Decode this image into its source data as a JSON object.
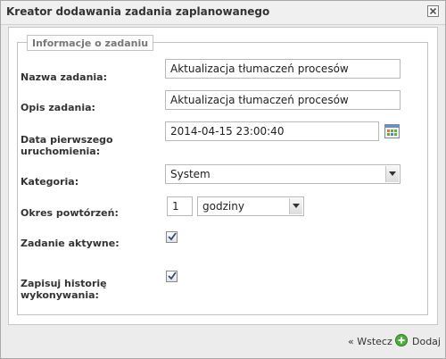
{
  "dialog": {
    "title": "Kreator dodawania zadania zaplanowanego",
    "close_icon": "close-icon"
  },
  "section": {
    "legend": "Informacje o zadaniu"
  },
  "form": {
    "task_name": {
      "label": "Nazwa zadania:",
      "value": "Aktualizacja tłumaczeń procesów"
    },
    "task_description": {
      "label": "Opis zadania:",
      "value": "Aktualizacja tłumaczeń procesów"
    },
    "first_run_date": {
      "label": "Data pierwszego uruchomienia:",
      "value": "2014-04-15 23:00:40",
      "icon": "calendar-icon"
    },
    "category": {
      "label": "Kategoria:",
      "selected": "System"
    },
    "repeat_interval": {
      "label": "Okres powtórzeń:",
      "amount": "1",
      "unit_selected": "godziny"
    },
    "task_active": {
      "label": "Zadanie aktywne:",
      "checked": true
    },
    "save_history": {
      "label": "Zapisuj historię wykonywania:",
      "checked": true
    }
  },
  "footer": {
    "back_label": "« Wstecz",
    "add_label": "Dodaj",
    "add_icon": "plus-circle-icon",
    "add_icon_color": "#4cae3d"
  }
}
